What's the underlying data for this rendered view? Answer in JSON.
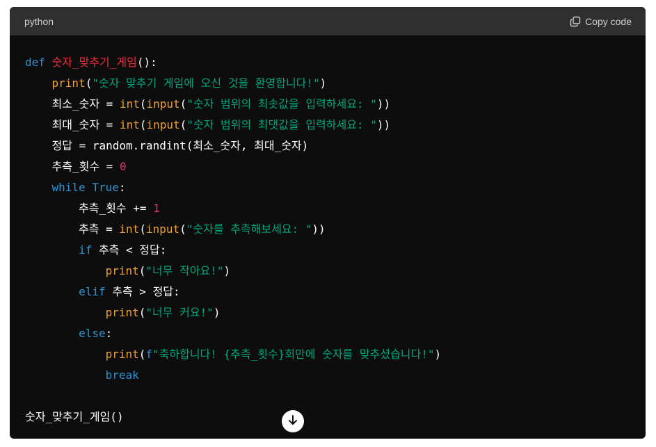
{
  "header": {
    "language": "python",
    "copy_label": "Copy code",
    "copy_icon": "clipboard-icon"
  },
  "colors": {
    "keyword": "#2e95d3",
    "function_name": "#f22c3d",
    "builtin": "#f0a030",
    "string": "#00a67d",
    "number": "#df3079",
    "plain": "#ffffff",
    "background": "#0d0d0d",
    "header_background": "#2f2f2f"
  },
  "code": {
    "lines": [
      [
        {
          "t": "def",
          "c": "k"
        },
        {
          "t": " ",
          "c": ""
        },
        {
          "t": "숫자_맞추기_게임",
          "c": "f"
        },
        {
          "t": "():",
          "c": ""
        }
      ],
      [
        {
          "t": "    ",
          "c": ""
        },
        {
          "t": "print",
          "c": "fn"
        },
        {
          "t": "(",
          "c": ""
        },
        {
          "t": "\"숫자 맞추기 게임에 오신 것을 환영합니다!\"",
          "c": "s"
        },
        {
          "t": ")",
          "c": ""
        }
      ],
      [
        {
          "t": "    최소_숫자 = ",
          "c": ""
        },
        {
          "t": "int",
          "c": "fn"
        },
        {
          "t": "(",
          "c": ""
        },
        {
          "t": "input",
          "c": "fn"
        },
        {
          "t": "(",
          "c": ""
        },
        {
          "t": "\"숫자 범위의 최솟값을 입력하세요: \"",
          "c": "s"
        },
        {
          "t": "))",
          "c": ""
        }
      ],
      [
        {
          "t": "    최대_숫자 = ",
          "c": ""
        },
        {
          "t": "int",
          "c": "fn"
        },
        {
          "t": "(",
          "c": ""
        },
        {
          "t": "input",
          "c": "fn"
        },
        {
          "t": "(",
          "c": ""
        },
        {
          "t": "\"숫자 범위의 최댓값을 입력하세요: \"",
          "c": "s"
        },
        {
          "t": "))",
          "c": ""
        }
      ],
      [
        {
          "t": "    정답 = random.randint(최소_숫자, 최대_숫자)",
          "c": ""
        }
      ],
      [
        {
          "t": "    추측_횟수 = ",
          "c": ""
        },
        {
          "t": "0",
          "c": "n"
        }
      ],
      [
        {
          "t": "    ",
          "c": ""
        },
        {
          "t": "while",
          "c": "k"
        },
        {
          "t": " ",
          "c": ""
        },
        {
          "t": "True",
          "c": "k"
        },
        {
          "t": ":",
          "c": ""
        }
      ],
      [
        {
          "t": "        추측_횟수 += ",
          "c": ""
        },
        {
          "t": "1",
          "c": "n"
        }
      ],
      [
        {
          "t": "        추측 = ",
          "c": ""
        },
        {
          "t": "int",
          "c": "fn"
        },
        {
          "t": "(",
          "c": ""
        },
        {
          "t": "input",
          "c": "fn"
        },
        {
          "t": "(",
          "c": ""
        },
        {
          "t": "\"숫자를 추측해보세요: \"",
          "c": "s"
        },
        {
          "t": "))",
          "c": ""
        }
      ],
      [
        {
          "t": "        ",
          "c": ""
        },
        {
          "t": "if",
          "c": "k"
        },
        {
          "t": " 추측 < 정답:",
          "c": ""
        }
      ],
      [
        {
          "t": "            ",
          "c": ""
        },
        {
          "t": "print",
          "c": "fn"
        },
        {
          "t": "(",
          "c": ""
        },
        {
          "t": "\"너무 작아요!\"",
          "c": "s"
        },
        {
          "t": ")",
          "c": ""
        }
      ],
      [
        {
          "t": "        ",
          "c": ""
        },
        {
          "t": "elif",
          "c": "k"
        },
        {
          "t": " 추측 > 정답:",
          "c": ""
        }
      ],
      [
        {
          "t": "            ",
          "c": ""
        },
        {
          "t": "print",
          "c": "fn"
        },
        {
          "t": "(",
          "c": ""
        },
        {
          "t": "\"너무 커요!\"",
          "c": "s"
        },
        {
          "t": ")",
          "c": ""
        }
      ],
      [
        {
          "t": "        ",
          "c": ""
        },
        {
          "t": "else",
          "c": "k"
        },
        {
          "t": ":",
          "c": ""
        }
      ],
      [
        {
          "t": "            ",
          "c": ""
        },
        {
          "t": "print",
          "c": "fn"
        },
        {
          "t": "(",
          "c": ""
        },
        {
          "t": "f",
          "c": "k"
        },
        {
          "t": "\"축하합니다! {추측_횟수}회만에 숫자를 맞추셨습니다!\"",
          "c": "s"
        },
        {
          "t": ")",
          "c": ""
        }
      ],
      [
        {
          "t": "            ",
          "c": ""
        },
        {
          "t": "break",
          "c": "k"
        }
      ],
      [],
      [
        {
          "t": "숫자_맞추기_게임()",
          "c": ""
        }
      ]
    ]
  },
  "scroll_button": {
    "icon": "arrow-down-icon"
  }
}
